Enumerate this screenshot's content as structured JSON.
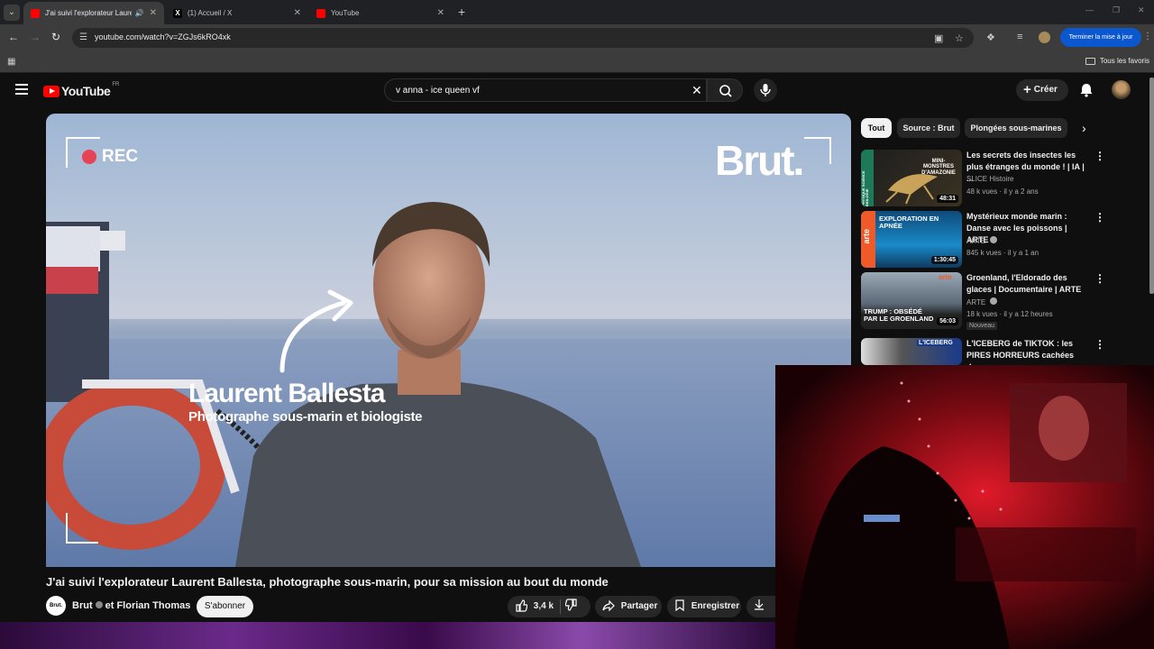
{
  "browser": {
    "tabs": [
      {
        "title": "J'ai suivi l'explorateur Laurent",
        "favicon": "youtube-icon",
        "active": true
      },
      {
        "title": "(1) Accueil / X",
        "favicon": "x-icon",
        "active": false
      },
      {
        "title": "YouTube",
        "favicon": "youtube-icon",
        "active": false
      }
    ],
    "url": "youtube.com/watch?v=ZGJs6kRO4xk",
    "update_button": "Terminer la mise à jour",
    "bookmarks_all": "Tous les favoris"
  },
  "youtube": {
    "logo_text": "YouTube",
    "country": "FR",
    "search_query": "v anna - ice queen vf",
    "create_label": "Créer"
  },
  "video": {
    "overlay_rec": "REC",
    "overlay_brand": "Brut.",
    "overlay_name": "Laurent Ballesta",
    "overlay_role": "Photographe sous-marin et biologiste",
    "title": "J'ai suivi l'explorateur Laurent Ballesta, photographe sous-marin, pour sa mission au bout du monde",
    "channel": "Brut",
    "collab": "et Florian Thomas",
    "channel_avatar_text": "Brut.",
    "subscribe": "S'abonner",
    "likes": "3,4 k",
    "share": "Partager",
    "save": "Enregistrer",
    "next_cut": "Té"
  },
  "sidebar": {
    "chips": [
      "Tout",
      "Source : Brut",
      "Plongées sous-marines"
    ],
    "recommendations": [
      {
        "title": "Les secrets des insectes les plus étranges du monde ! | IA | ...",
        "channel": "SLICE Histoire",
        "views": "48 k vues",
        "age": "il y a 2 ans",
        "duration": "48:31",
        "thumb_text": "MINI-MONSTRES D'AMAZONIE",
        "thumb_side": "PHYSIQUE SCIENCE BIOLOGIE",
        "verified": false,
        "badge": ""
      },
      {
        "title": "Mystérieux monde marin : Danse avec les poissons | ARTE",
        "channel": "ARTE",
        "views": "845 k vues",
        "age": "il y a 1 an",
        "duration": "1:30:45",
        "thumb_text": "EXPLORATION EN APNÉE",
        "thumb_side": "arte",
        "verified": true,
        "badge": ""
      },
      {
        "title": "Groenland, l'Eldorado des glaces | Documentaire | ARTE",
        "channel": "ARTE",
        "views": "18 k vues",
        "age": "il y a 12 heures",
        "duration": "56:03",
        "thumb_text": "TRUMP : OBSÉDÉ PAR LE GROENLAND",
        "thumb_side": "arte",
        "verified": true,
        "badge": "Nouveau"
      },
      {
        "title": "L'ICEBERG de TIKTOK : les PIRES HORREURS cachées de...",
        "channel": "",
        "views": "",
        "age": "",
        "duration": "",
        "thumb_text": "L'ICEBERG",
        "thumb_side": "",
        "verified": false,
        "badge": ""
      }
    ]
  },
  "colors": {
    "yt_red": "#ff0000",
    "page_bg": "#0f0f0f",
    "update_blue": "#0b57d0"
  }
}
